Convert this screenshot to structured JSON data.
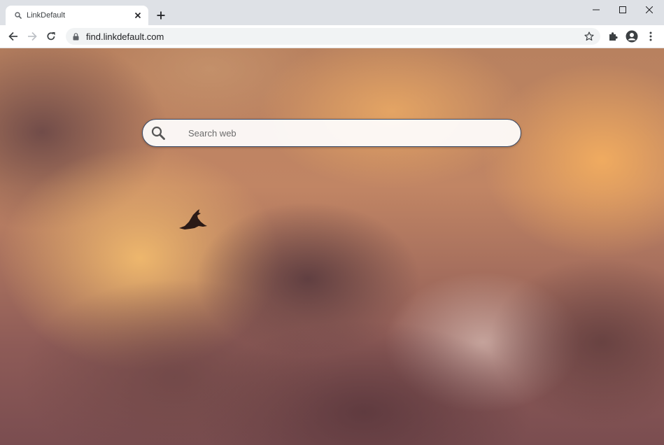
{
  "browser": {
    "tab": {
      "title": "LinkDefault",
      "favicon": "search-icon"
    },
    "new_tab_icon": "plus-icon",
    "window_controls": [
      "minimize-icon",
      "maximize-icon",
      "close-icon"
    ],
    "address_bar": {
      "url": "find.linkdefault.com",
      "secure_icon": "lock-icon"
    },
    "toolbar_icons": [
      "back-icon",
      "forward-icon",
      "reload-icon",
      "star-icon",
      "extensions-icon",
      "profile-icon",
      "menu-icon"
    ]
  },
  "page": {
    "search": {
      "placeholder": "Search web",
      "value": ""
    },
    "background": {
      "accent_colors": [
        "#c18564",
        "#f5b05f",
        "#7a4d50"
      ]
    }
  }
}
